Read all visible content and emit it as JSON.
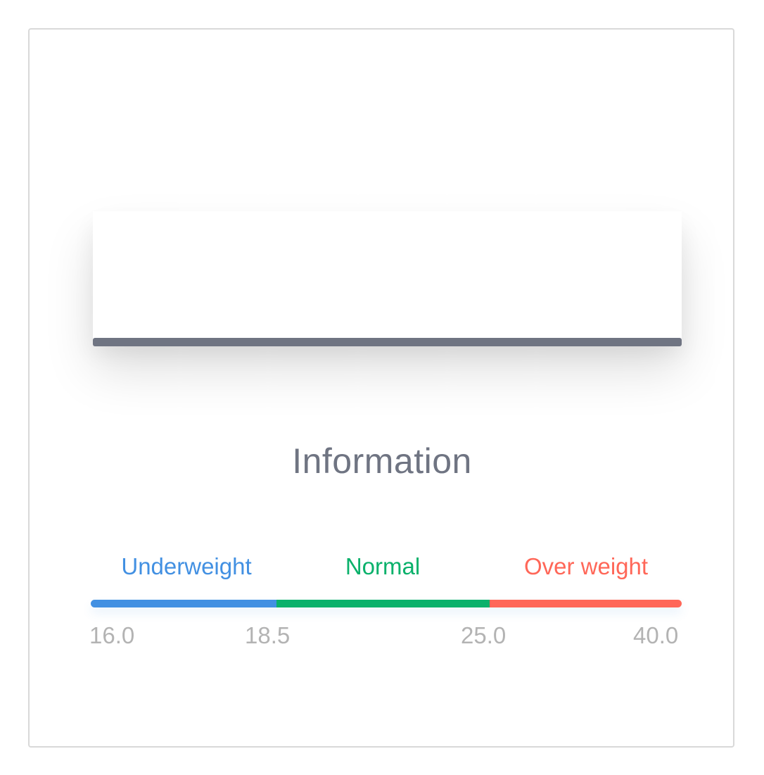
{
  "info": {
    "title": "Information"
  },
  "categories": [
    {
      "label": "Underweight",
      "color": "#4290e2",
      "from": 16.0,
      "to": 18.5
    },
    {
      "label": "Normal",
      "color": "#0ab16b",
      "from": 18.5,
      "to": 25.0
    },
    {
      "label": "Over weight",
      "color": "#ff6758",
      "from": 25.0,
      "to": 40.0
    }
  ],
  "scale": {
    "ticks": [
      "16.0",
      "18.5",
      "25.0",
      "40.0"
    ]
  },
  "colors": {
    "panel_bar": "#6f7482",
    "title": "#6f7482",
    "tick": "#b3b3b3"
  }
}
